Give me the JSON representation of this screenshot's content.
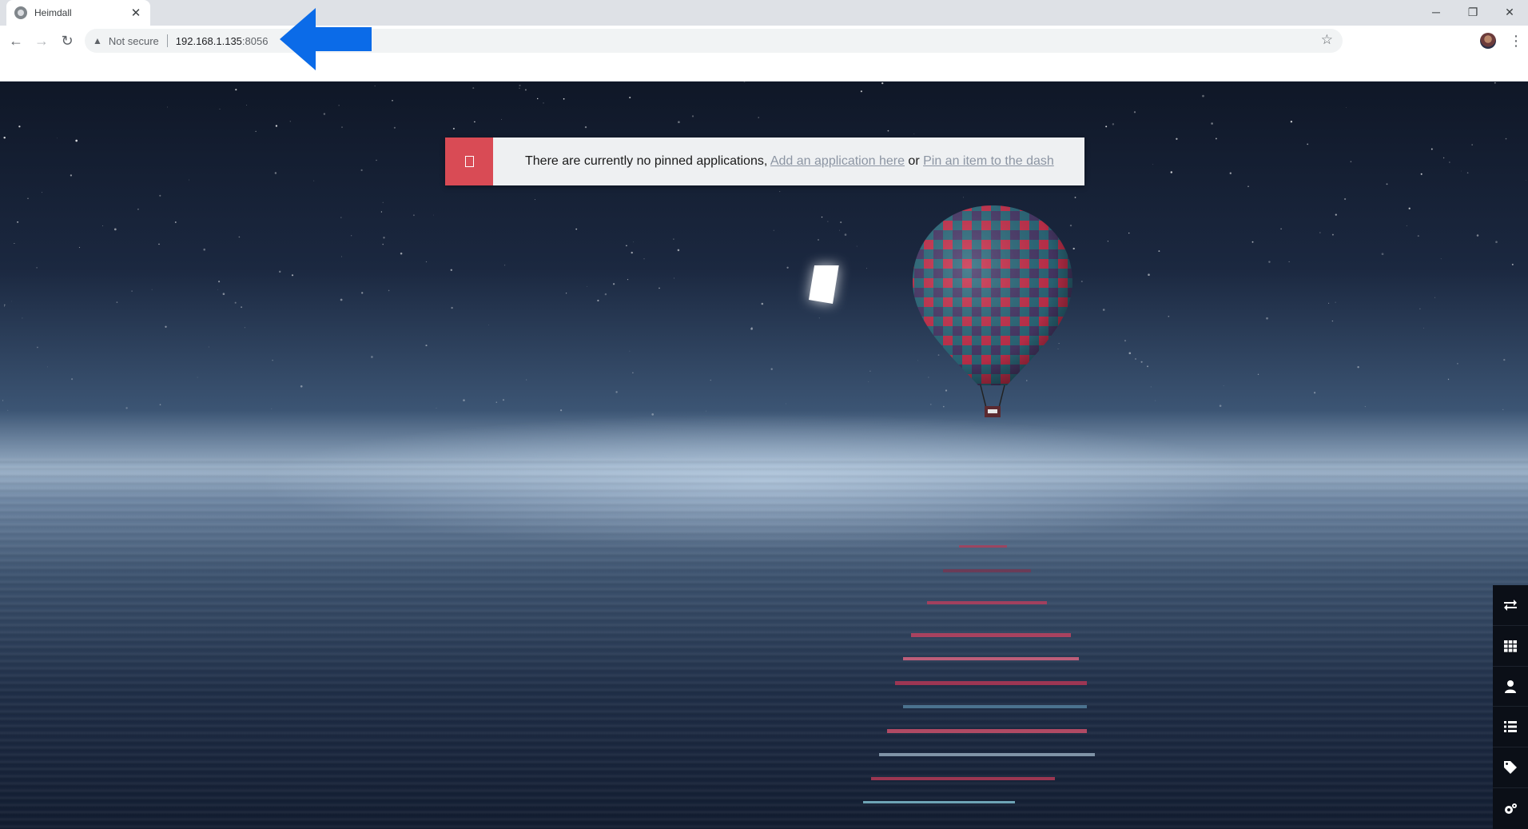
{
  "browser": {
    "tab_title": "Heimdall",
    "tab_close": "✕",
    "window_controls": {
      "minimize": "─",
      "restore": "❐",
      "close": "✕"
    },
    "nav": {
      "back": "←",
      "forward": "→",
      "reload": "↻"
    },
    "security_label": "Not secure",
    "url_host": "192.168.1.135",
    "url_port": ":8056",
    "bookmark_star": "☆",
    "menu": "⋮"
  },
  "alert": {
    "text": "There are currently no pinned applications, ",
    "link_add": "Add an application here",
    "connector": " or ",
    "link_pin": "Pin an item to the dash"
  },
  "dock": [
    {
      "name": "switch-view-icon"
    },
    {
      "name": "grid-icon"
    },
    {
      "name": "user-icon"
    },
    {
      "name": "list-icon"
    },
    {
      "name": "tag-icon"
    },
    {
      "name": "settings-icon"
    }
  ],
  "colors": {
    "alert_badge": "#d94b55",
    "annotation_blue": "#0b6be8",
    "annotation_white": "#ffffff",
    "dock_bg": "#0b0f17"
  }
}
